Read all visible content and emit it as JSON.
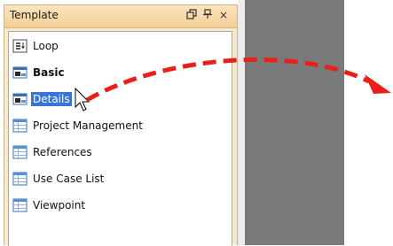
{
  "panel": {
    "title": "Template",
    "restore_icon": "restore-window-icon",
    "pin_icon": "pin-icon",
    "close_icon": "close-icon",
    "close_glyph": "×"
  },
  "items": [
    {
      "label": "Loop",
      "icon": "loop-template-icon"
    },
    {
      "label": "Basic",
      "icon": "basic-template-icon",
      "bold": true
    },
    {
      "label": "Details",
      "icon": "details-template-icon",
      "selected": true
    },
    {
      "label": "Project Management",
      "icon": "table-template-icon"
    },
    {
      "label": "References",
      "icon": "table-template-icon"
    },
    {
      "label": "Use Case List",
      "icon": "table-template-icon"
    },
    {
      "label": "Viewpoint",
      "icon": "table-template-icon"
    }
  ],
  "colors": {
    "selection": "#3875d7",
    "arrow": "#e8201a",
    "panel_header": "#f3cf95",
    "gray_area": "#7a7a7a"
  }
}
